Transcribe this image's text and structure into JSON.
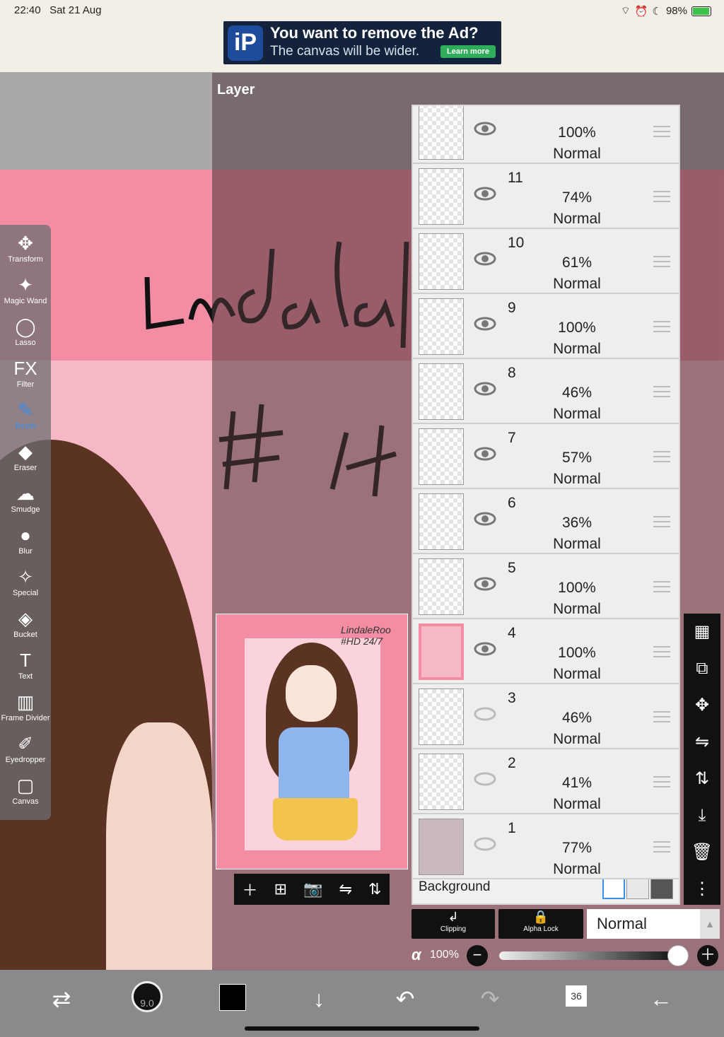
{
  "status_bar": {
    "time": "22:40",
    "date": "Sat 21 Aug",
    "battery": "98%"
  },
  "ad": {
    "title": "You want to remove the Ad?",
    "subtitle": "The canvas will be wider.",
    "button": "Learn more"
  },
  "layer_panel_title": "Layer",
  "thumbnail_signature": "LindaleRoo #HD 24/7",
  "tools": [
    {
      "label": "Transform",
      "icon": "move-icon"
    },
    {
      "label": "Magic Wand",
      "icon": "magic-wand-icon"
    },
    {
      "label": "Lasso",
      "icon": "lasso-icon"
    },
    {
      "label": "Filter",
      "icon": "fx-icon"
    },
    {
      "label": "Brush",
      "icon": "brush-icon"
    },
    {
      "label": "Eraser",
      "icon": "eraser-icon"
    },
    {
      "label": "Smudge",
      "icon": "smudge-icon"
    },
    {
      "label": "Blur",
      "icon": "blur-icon"
    },
    {
      "label": "Special",
      "icon": "special-icon"
    },
    {
      "label": "Bucket",
      "icon": "bucket-icon"
    },
    {
      "label": "Text",
      "icon": "text-icon"
    },
    {
      "label": "Frame Divider",
      "icon": "frame-divider-icon"
    },
    {
      "label": "Eyedropper",
      "icon": "eyedropper-icon"
    },
    {
      "label": "Canvas",
      "icon": "canvas-icon"
    }
  ],
  "active_tool": "Brush",
  "layers": [
    {
      "num": "",
      "opacity": "100%",
      "mode": "Normal",
      "visible": true
    },
    {
      "num": "11",
      "opacity": "74%",
      "mode": "Normal",
      "visible": true
    },
    {
      "num": "10",
      "opacity": "61%",
      "mode": "Normal",
      "visible": true
    },
    {
      "num": "9",
      "opacity": "100%",
      "mode": "Normal",
      "visible": true
    },
    {
      "num": "8",
      "opacity": "46%",
      "mode": "Normal",
      "visible": true
    },
    {
      "num": "7",
      "opacity": "57%",
      "mode": "Normal",
      "visible": true
    },
    {
      "num": "6",
      "opacity": "36%",
      "mode": "Normal",
      "visible": true
    },
    {
      "num": "5",
      "opacity": "100%",
      "mode": "Normal",
      "visible": true
    },
    {
      "num": "4",
      "opacity": "100%",
      "mode": "Normal",
      "visible": true
    },
    {
      "num": "3",
      "opacity": "46%",
      "mode": "Normal",
      "visible": false
    },
    {
      "num": "2",
      "opacity": "41%",
      "mode": "Normal",
      "visible": false
    },
    {
      "num": "1",
      "opacity": "77%",
      "mode": "Normal",
      "visible": false
    }
  ],
  "background_label": "Background",
  "clipping_label": "Clipping",
  "alpha_lock_label": "Alpha Lock",
  "blend_mode": "Normal",
  "alpha_symbol": "α",
  "alpha_value": "100%",
  "brush_size": "9.0",
  "page_count": "36",
  "colors": {
    "accent": "#3a8fe8",
    "canvas_pink": "#f28da3",
    "current_color": "#000000"
  }
}
